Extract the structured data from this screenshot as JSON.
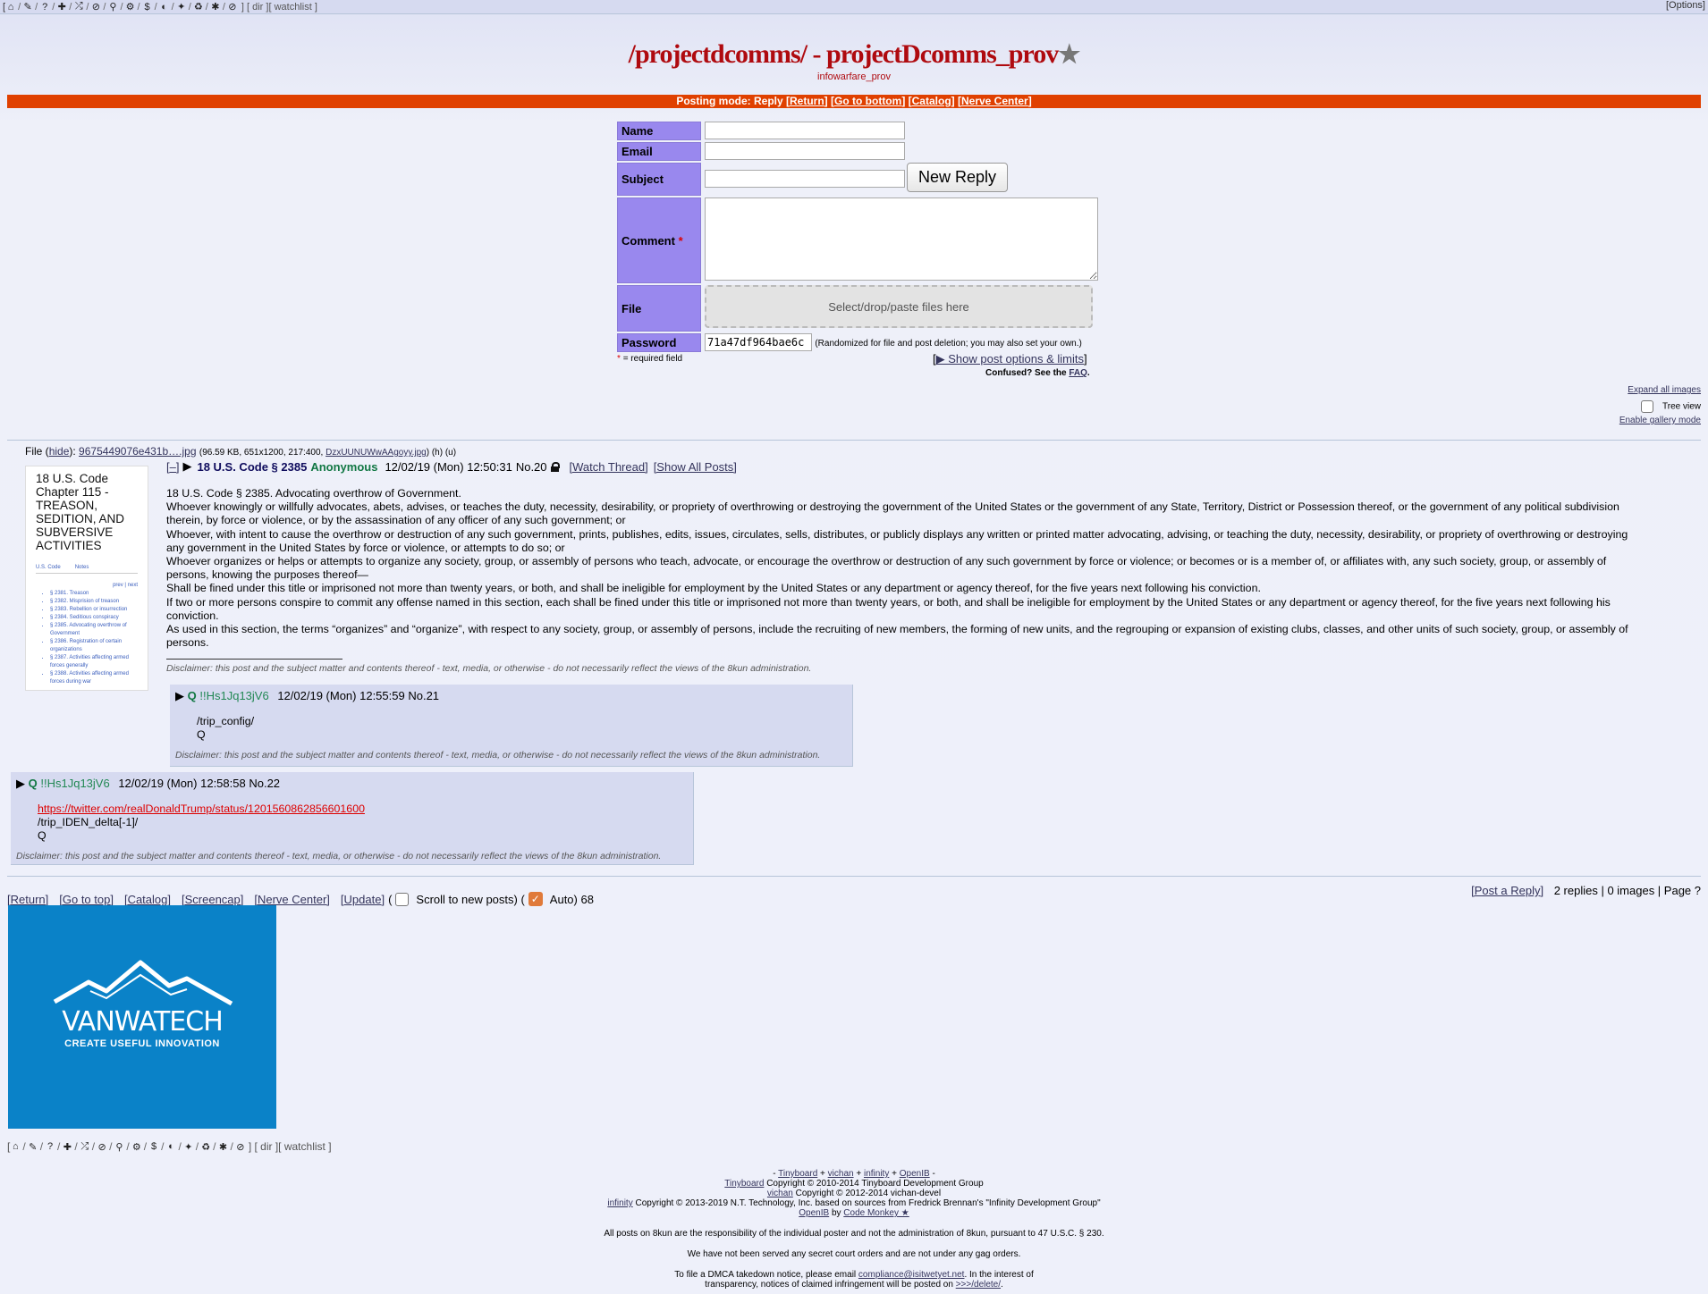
{
  "topbar": {
    "icons": [
      "home-icon",
      "tags-icon",
      "question-icon",
      "plus-icon",
      "shuffle-icon",
      "ban-icon",
      "search-icon",
      "gear-icon",
      "dollar-icon",
      "contrast-icon",
      "twitter-icon",
      "recycle-icon",
      "bug-icon",
      "slash-circle-icon"
    ],
    "dir": "dir",
    "watchlist": "watchlist",
    "options": "[Options]"
  },
  "board": {
    "title": "/projectdcomms/ - projectDcomms_prov",
    "star": "★",
    "subtitle": "infowarfare_prov"
  },
  "modebar": {
    "prefix": "Posting mode: Reply",
    "links": [
      "Return",
      "Go to bottom",
      "Catalog",
      "Nerve Center"
    ]
  },
  "form": {
    "name_label": "Name",
    "email_label": "Email",
    "subject_label": "Subject",
    "submit_label": "New Reply",
    "comment_label": "Comment",
    "required_mark": "*",
    "file_label": "File",
    "file_drop": "Select/drop/paste files here",
    "password_label": "Password",
    "password_value": "71a47df964bae6c",
    "password_note": "(Randomized for file and post deletion; you may also set your own.)",
    "required_note": "= required field",
    "show_options": "▶ Show post options & limits",
    "confused": "Confused? See the",
    "faq": "FAQ"
  },
  "tools": {
    "expand_images": "Expand all images",
    "tree_view": "Tree view",
    "gallery": "Enable gallery mode"
  },
  "op": {
    "file_label": "File",
    "hide": "hide",
    "filename": "9675449076e431b….jpg",
    "file_meta": "(96.59 KB, 651x1200, 217:400,",
    "orig_name": "DzxUUNUWwAAgoyy.jpg",
    "file_tail": ") (h) (u)",
    "thumb_title": "18 U.S. Code Chapter 115 - TREASON, SEDITION, AND SUBVERSIVE ACTIVITIES",
    "thumb_nav": [
      "U.S. Code",
      "Notes"
    ],
    "thumb_nav_right": "prev | next",
    "thumb_items": [
      "§ 2381. Treason",
      "§ 2382. Misprision of treason",
      "§ 2383. Rebellion or insurrection",
      "§ 2384. Seditious conspiracy",
      "§ 2385. Advocating overthrow of Government",
      "§ 2386. Registration of certain organizations",
      "§ 2387. Activities affecting armed forces generally",
      "§ 2388. Activities affecting armed forces during war"
    ],
    "collapse": "[–]",
    "subject": "18 U.S. Code § 2385",
    "name": "Anonymous",
    "date": "12/02/19 (Mon) 12:50:31",
    "no": "No.20",
    "watch": "[Watch Thread]",
    "show_all": "[Show All Posts]",
    "body": [
      "18 U.S. Code § 2385. Advocating overthrow of Government.",
      "Whoever knowingly or willfully advocates, abets, advises, or teaches the duty, necessity, desirability, or propriety of overthrowing or destroying the government of the United States or the government of any State, Territory, District or Possession thereof, or the government of any political subdivision therein, by force or violence, or by the assassination of any officer of any such government; or",
      "Whoever, with intent to cause the overthrow or destruction of any such government, prints, publishes, edits, issues, circulates, sells, distributes, or publicly displays any written or printed matter advocating, advising, or teaching the duty, necessity, desirability, or propriety of overthrowing or destroying any government in the United States by force or violence, or attempts to do so; or",
      "Whoever organizes or helps or attempts to organize any society, group, or assembly of persons who teach, advocate, or encourage the overthrow or destruction of any such government by force or violence; or becomes or is a member of, or affiliates with, any such society, group, or assembly of persons, knowing the purposes thereof—",
      "Shall be fined under this title or imprisoned not more than twenty years, or both, and shall be ineligible for employment by the United States or any department or agency thereof, for the five years next following his conviction.",
      "If two or more persons conspire to commit any offense named in this section, each shall be fined under this title or imprisoned not more than twenty years, or both, and shall be ineligible for employment by the United States or any department or agency thereof, for the five years next following his conviction.",
      "As used in this section, the terms “organizes” and “organize”, with respect to any society, group, or assembly of persons, include the recruiting of new members, the forming of new units, and the regrouping or expansion of existing clubs, classes, and other units of such society, group, or assembly of persons."
    ],
    "disclaimer": "Disclaimer: this post and the subject matter and contents thereof - text, media, or otherwise - do not necessarily reflect the views of the 8kun administration."
  },
  "replies": [
    {
      "name": "Q",
      "trip": "!!Hs1Jq13jV6",
      "date": "12/02/19 (Mon) 12:55:59",
      "no": "No.21",
      "lines": [
        "/trip_config/",
        "Q"
      ],
      "disclaimer": "Disclaimer: this post and the subject matter and contents thereof - text, media, or otherwise - do not necessarily reflect the views of the 8kun administration."
    },
    {
      "name": "Q",
      "trip": "!!Hs1Jq13jV6",
      "date": "12/02/19 (Mon) 12:58:58",
      "no": "No.22",
      "link": "https://twitter.com/realDonaldTrump/status/1201560862856601600",
      "lines": [
        "/trip_IDEN_delta[-1]/",
        "Q"
      ],
      "disclaimer": "Disclaimer: this post and the subject matter and contents thereof - text, media, or otherwise - do not necessarily reflect the views of the 8kun administration."
    }
  ],
  "bottom": {
    "links": [
      "[Return]",
      "[Go to top]",
      "[Catalog]",
      "[Screencap]",
      "[Nerve Center]",
      "[Update]"
    ],
    "paren_open": "(",
    "scroll_label": "Scroll to new posts) (",
    "auto_label": "Auto) 68",
    "post_reply": "[Post a Reply]",
    "stats": "2 replies | 0 images | Page ?"
  },
  "banner": {
    "brand": "VANWATECH",
    "tagline": "CREATE USEFUL INNOVATION",
    "bg": "#0a82c8"
  },
  "footer": {
    "line1_prefix": "-",
    "tinyboard": "Tinyboard",
    "plus": "+",
    "vichan": "vichan",
    "infinity": "infinity",
    "openib": "OpenIB",
    "line1_suffix": "-",
    "l2": "Copyright © 2010-2014 Tinyboard Development Group",
    "l3": "Copyright © 2012-2014 vichan-devel",
    "l4": "Copyright © 2013-2019 N.T. Technology, Inc. based on sources from Fredrick Brennan's \"Infinity Development Group\"",
    "l5_by": "by",
    "code_monkey": "Code Monkey ★",
    "notice1": "All posts on 8kun are the responsibility of the individual poster and not the administration of 8kun, pursuant to 47 U.S.C. § 230.",
    "notice2": "We have not been served any secret court orders and are not under any gag orders.",
    "dmca_pre": "To file a DMCA takedown notice, please email",
    "dmca_email": "compliance@isitwetyet.net",
    "dmca_mid": ". In the interest of",
    "dmca_line2": "transparency, notices of claimed infringement will be posted on",
    "dmca_link": ">>>/delete/",
    "dmca_end": "."
  }
}
